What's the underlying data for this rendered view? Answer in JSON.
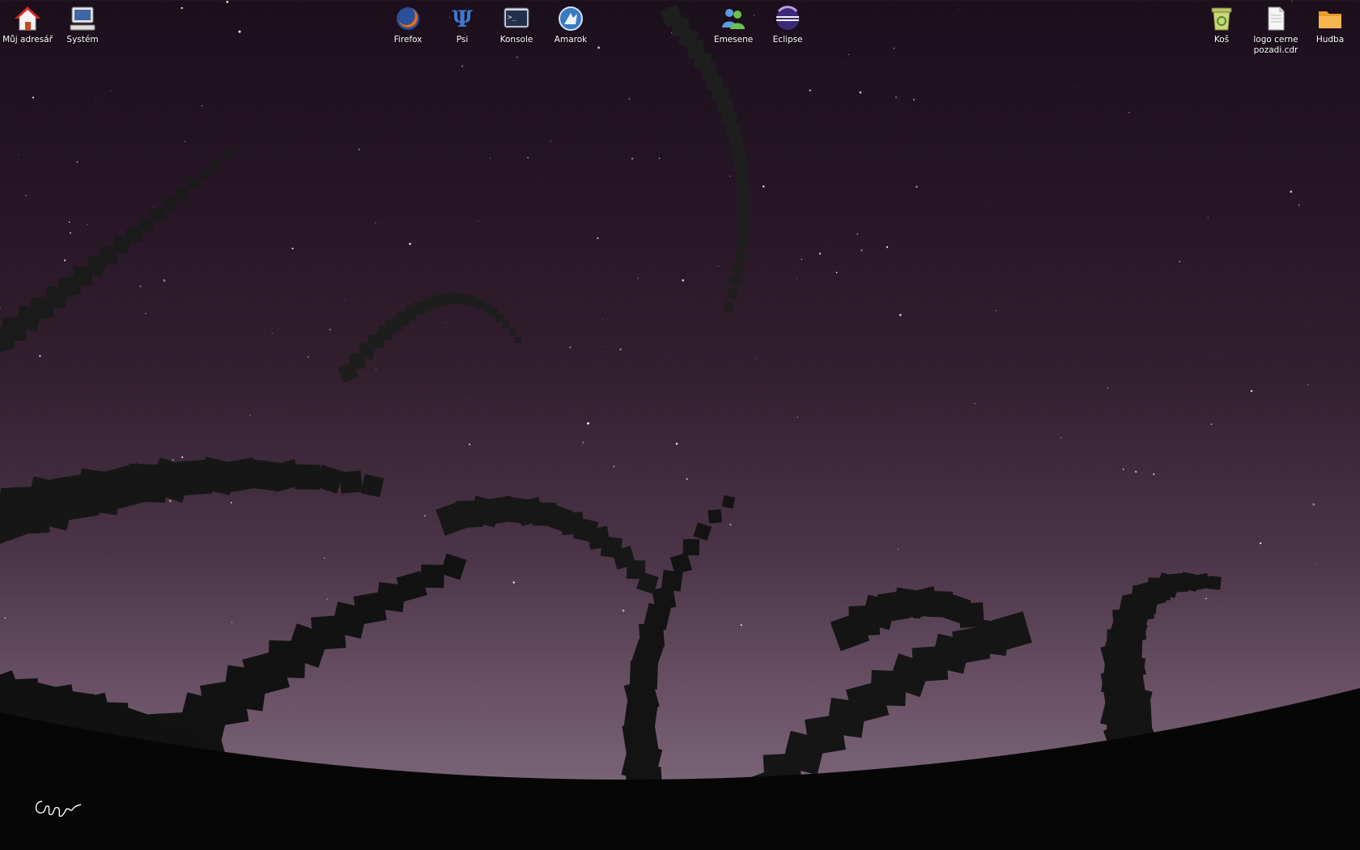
{
  "desktop": {
    "icons_left": [
      {
        "name": "home-icon",
        "label": "Můj adresář"
      },
      {
        "name": "computer-icon",
        "label": "Systém"
      }
    ],
    "icons_center": [
      {
        "name": "firefox-icon",
        "label": "Firefox"
      },
      {
        "name": "psi-icon",
        "label": "Psi"
      },
      {
        "name": "terminal-icon",
        "label": "Konsole"
      },
      {
        "name": "amarok-icon",
        "label": "Amarok"
      },
      {
        "name": "emesene-icon",
        "label": "Emesene"
      },
      {
        "name": "eclipse-icon",
        "label": "Eclipse"
      }
    ],
    "icons_right": [
      {
        "name": "trash-icon",
        "label": "Koš"
      },
      {
        "name": "document-icon",
        "label": "logo cerne pozadi.cdr"
      },
      {
        "name": "folder-icon",
        "label": "Hudba"
      }
    ]
  },
  "colors": {
    "sky_top": "#1c0f1c",
    "sky_bottom": "#7a6377",
    "ground": "#060606",
    "shapes": "#111111"
  }
}
